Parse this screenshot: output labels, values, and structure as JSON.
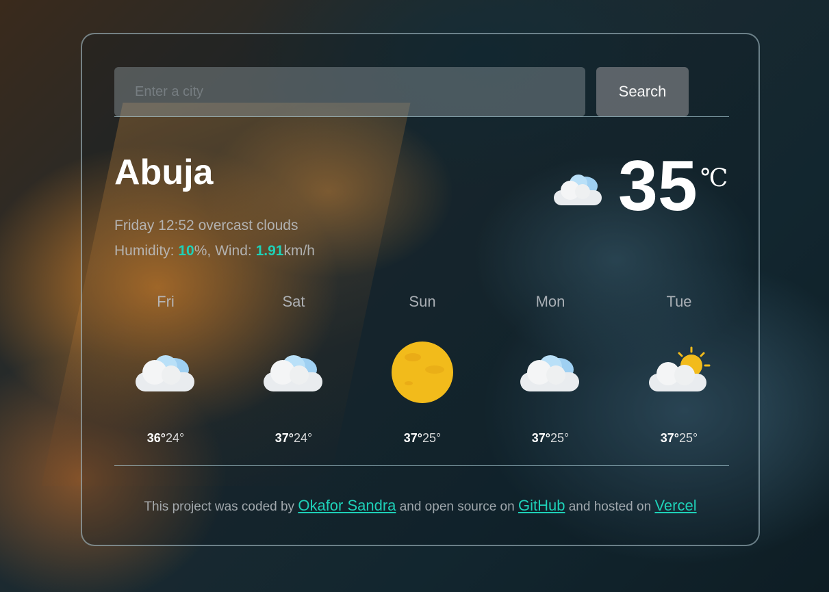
{
  "search": {
    "placeholder": "Enter a city",
    "button_label": "Search"
  },
  "current": {
    "city": "Abuja",
    "day_time": "Friday 12:52",
    "condition": "overcast clouds",
    "humidity_label": "Humidity: ",
    "humidity_value": "10",
    "humidity_unit": "%",
    "wind_label": ", Wind: ",
    "wind_value": "1.91",
    "wind_unit": "km/h",
    "temperature": "35",
    "unit": "℃",
    "icon": "cloud-icon"
  },
  "forecast": [
    {
      "day": "Fri",
      "max": "36°",
      "min": "24°",
      "icon": "cloud-icon"
    },
    {
      "day": "Sat",
      "max": "37°",
      "min": "24°",
      "icon": "cloud-icon"
    },
    {
      "day": "Sun",
      "max": "37°",
      "min": "25°",
      "icon": "sun-icon"
    },
    {
      "day": "Mon",
      "max": "37°",
      "min": "25°",
      "icon": "cloud-icon"
    },
    {
      "day": "Tue",
      "max": "37°",
      "min": "25°",
      "icon": "partly-cloudy-icon"
    }
  ],
  "footer": {
    "text1": "This project was coded by ",
    "author_link": "Okafor Sandra",
    "text2": " and open source on ",
    "github_link": "GitHub",
    "text3": " and hosted on ",
    "vercel_link": "Vercel"
  },
  "colors": {
    "accent": "#1ed1b8",
    "sun": "#f2bb1b"
  }
}
